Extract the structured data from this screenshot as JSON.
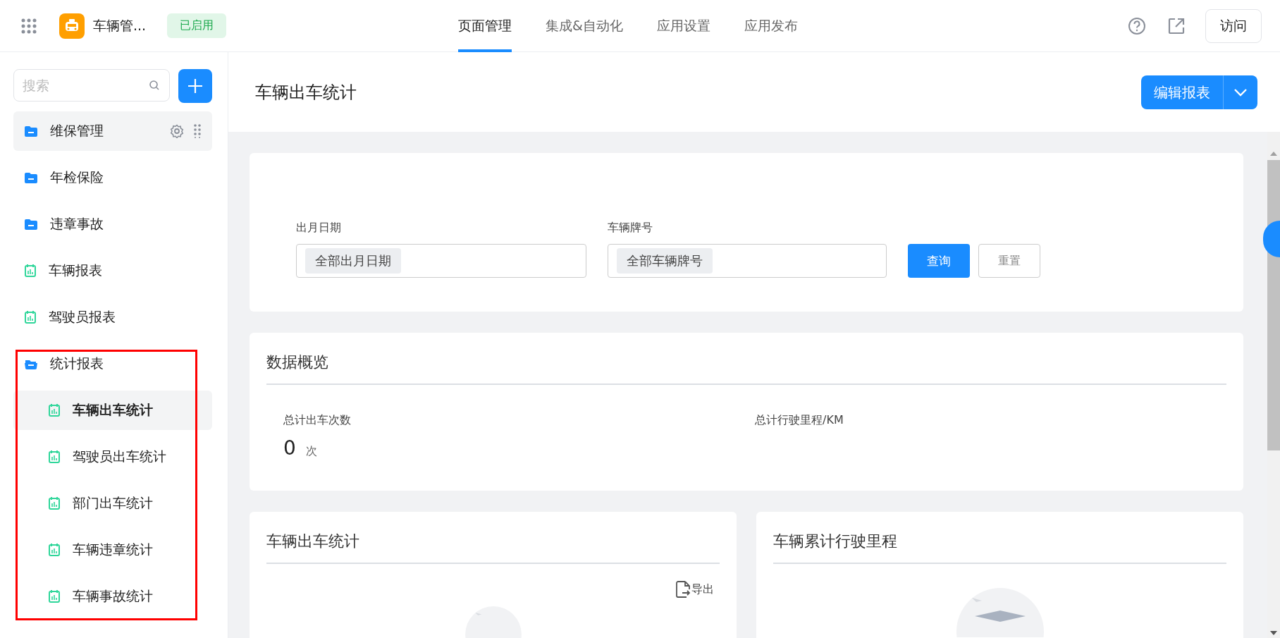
{
  "top_bar": {
    "app_name": "车辆管...",
    "status_badge": "已启用",
    "nav_tabs": [
      {
        "label": "页面管理",
        "selected": true
      },
      {
        "label": "集成&自动化",
        "selected": false
      },
      {
        "label": "应用设置",
        "selected": false
      },
      {
        "label": "应用发布",
        "selected": false
      }
    ],
    "visit_button": "访问"
  },
  "sidebar": {
    "search": {
      "placeholder": "搜索"
    },
    "items": [
      {
        "kind": "folder",
        "label": "维保管理",
        "selected": false,
        "hovered": true,
        "expanded": false
      },
      {
        "kind": "folder",
        "label": "年检保险",
        "selected": false,
        "hovered": false,
        "expanded": false
      },
      {
        "kind": "folder",
        "label": "违章事故",
        "selected": false,
        "hovered": false,
        "expanded": false
      },
      {
        "kind": "report",
        "label": "车辆报表",
        "selected": false,
        "hovered": false
      },
      {
        "kind": "report",
        "label": "驾驶员报表",
        "selected": false,
        "hovered": false
      },
      {
        "kind": "folder",
        "label": "统计报表",
        "selected": false,
        "hovered": false,
        "expanded": true,
        "children": [
          {
            "kind": "report",
            "label": "车辆出车统计",
            "selected": true,
            "hovered": false
          },
          {
            "kind": "report",
            "label": "驾驶员出车统计",
            "selected": false,
            "hovered": false
          },
          {
            "kind": "report",
            "label": "部门出车统计",
            "selected": false,
            "hovered": false
          },
          {
            "kind": "report",
            "label": "车辆违章统计",
            "selected": false,
            "hovered": false
          },
          {
            "kind": "report",
            "label": "车辆事故统计",
            "selected": false,
            "hovered": false
          }
        ]
      }
    ]
  },
  "page": {
    "title": "车辆出车统计",
    "edit_button": "编辑报表",
    "filters": [
      {
        "label": "出月日期",
        "tag": "全部出月日期"
      },
      {
        "label": "车辆牌号",
        "tag": "全部车辆牌号"
      }
    ],
    "query_button": "查询",
    "reset_button": "重置",
    "overview": {
      "title": "数据概览",
      "stats": [
        {
          "label": "总计出车次数",
          "value": "0",
          "unit": "次"
        },
        {
          "label": "总计行驶里程/KM"
        }
      ]
    },
    "chart_cards": [
      {
        "title": "车辆出车统计",
        "export": "导出"
      },
      {
        "title": "车辆累计行驶里程"
      }
    ]
  }
}
